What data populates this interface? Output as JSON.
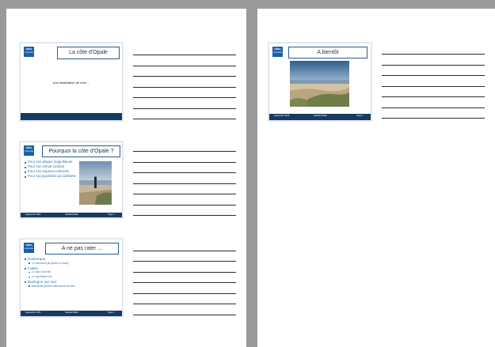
{
  "logo": {
    "main": "ulco",
    "sub": "université"
  },
  "slides": [
    {
      "title": "La côte d'Opale",
      "subtitle": "Une destination de rêve ..."
    },
    {
      "title": "Pourquoi la côte d'Opale ?",
      "bullets": [
        "Pour ses plages magnifiques",
        "Pour son climat vivifiant",
        "Pour ses espaces naturels",
        "Pour sa population accueillante"
      ],
      "footer": {
        "left": "Septembre 2019",
        "center": "Isabelle Boillot",
        "right": "Page 2"
      }
    },
    {
      "title": "A ne pas rater ...",
      "items": [
        {
          "text": "Dunkerque",
          "level": 1
        },
        {
          "text": "Le carnaval (de janvier à mars)",
          "level": 2
        },
        {
          "text": "Calais",
          "level": 1
        },
        {
          "text": "Le cap Gris Nez",
          "level": 2
        },
        {
          "text": "Le cap Blanc nez",
          "level": 2
        },
        {
          "text": "Boulogne sur mer",
          "level": 1
        },
        {
          "text": "Nausicaa (centre national de la mer)",
          "level": 2
        }
      ],
      "footer": {
        "left": "Septembre 2019",
        "center": "Isabelle Boillot",
        "right": "Page 3"
      }
    },
    {
      "title": "A bientôt",
      "footer": {
        "left": "Septembre 2019",
        "center": "Isabelle Boillot",
        "right": "Page 4"
      }
    }
  ],
  "colors": {
    "brand_blue": "#1b5fa8",
    "footer_navy": "#163a63",
    "bullet_blue": "#2e74b5",
    "page_gray": "#9a9a9a"
  }
}
